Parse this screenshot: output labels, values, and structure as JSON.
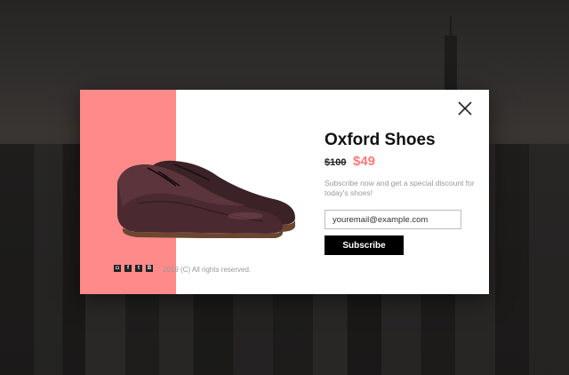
{
  "product": {
    "name": "Oxford Shoes",
    "old_price": "$100",
    "new_price": "$49"
  },
  "promo": {
    "description": "Subscribe now and get a special discount for today's shoes!"
  },
  "form": {
    "email_value": "youremail@example.com",
    "subscribe_label": "Subscribe"
  },
  "footer": {
    "copyright": "2019 (C) All rights reserved.",
    "social_icons": [
      "instagram-icon",
      "facebook-icon",
      "twitter-icon",
      "blogger-icon"
    ]
  },
  "colors": {
    "accent": "#ff8a8a",
    "price": "#ff7a7a",
    "button": "#000000"
  }
}
